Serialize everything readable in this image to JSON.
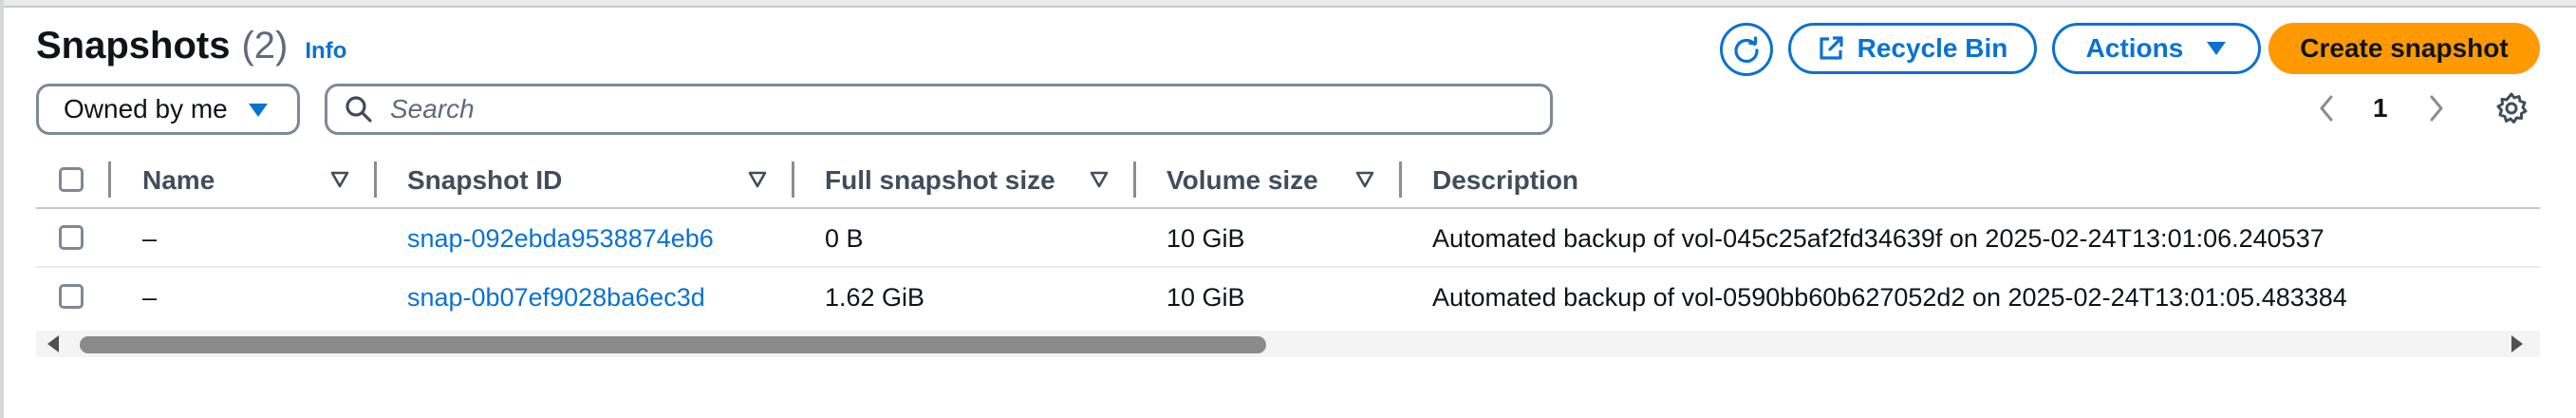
{
  "header": {
    "title": "Snapshots",
    "count": "(2)",
    "info_link": "Info"
  },
  "toolbar": {
    "refresh_icon": "refresh-icon",
    "recycle_bin_label": "Recycle Bin",
    "actions_label": "Actions",
    "create_label": "Create snapshot"
  },
  "filter": {
    "owner_selected": "Owned by me",
    "search_placeholder": "Search"
  },
  "pagination": {
    "current_page": "1"
  },
  "table": {
    "columns": [
      "Name",
      "Snapshot ID",
      "Full snapshot size",
      "Volume size",
      "Description"
    ],
    "rows": [
      {
        "name": "–",
        "snapshot_id": "snap-092ebda9538874eb6",
        "full_size": "0 B",
        "volume_size": "10 GiB",
        "description": "Automated backup of vol-045c25af2fd34639f on 2025-02-24T13:01:06.240537"
      },
      {
        "name": "–",
        "snapshot_id": "snap-0b07ef9028ba6ec3d",
        "full_size": "1.62 GiB",
        "volume_size": "10 GiB",
        "description": "Automated backup of vol-0590bb60b627052d2 on 2025-02-24T13:01:05.483384"
      }
    ]
  },
  "colors": {
    "link": "#0972d3",
    "primary_button": "#ff9900",
    "text": "#0f141a",
    "header_text": "#414d5c"
  }
}
